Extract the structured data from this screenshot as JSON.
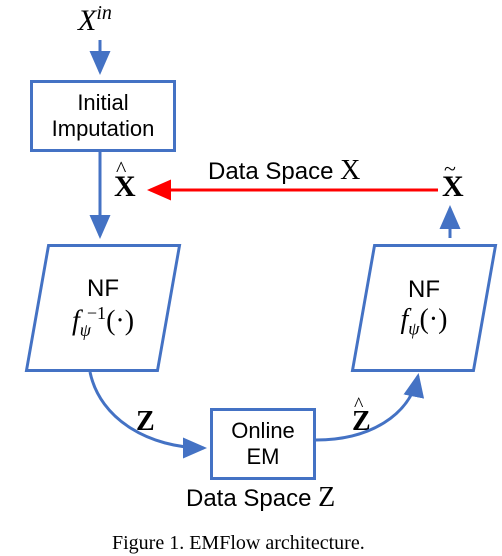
{
  "input_label": "X",
  "input_supscript": "in",
  "initial_box_line1": "Initial",
  "initial_box_line2": "Imputation",
  "xhat_base": "X",
  "xhat_hat": "^",
  "xtilde_base": "X",
  "xtilde_hat": "~",
  "data_space_X_label": "Data Space ",
  "data_space_X_sym": "X",
  "nf_label_left_line1": "NF",
  "nf_label_left_line2_f": "f",
  "nf_label_left_line2_sub": "ψ",
  "nf_label_left_line2_sup": "−1",
  "nf_label_left_line2_tail": "(·)",
  "nf_label_right_line1": "NF",
  "nf_label_right_line2_f": "f",
  "nf_label_right_line2_sub": "ψ",
  "nf_label_right_line2_tail": "(·)",
  "z_label": "Z",
  "zhat_base": "Z",
  "zhat_hat": "^",
  "online_em_line1": "Online",
  "online_em_line2": "EM",
  "data_space_Z_label": "Data Space ",
  "data_space_Z_sym": "Z",
  "caption": "Figure 1. EMFlow architecture."
}
